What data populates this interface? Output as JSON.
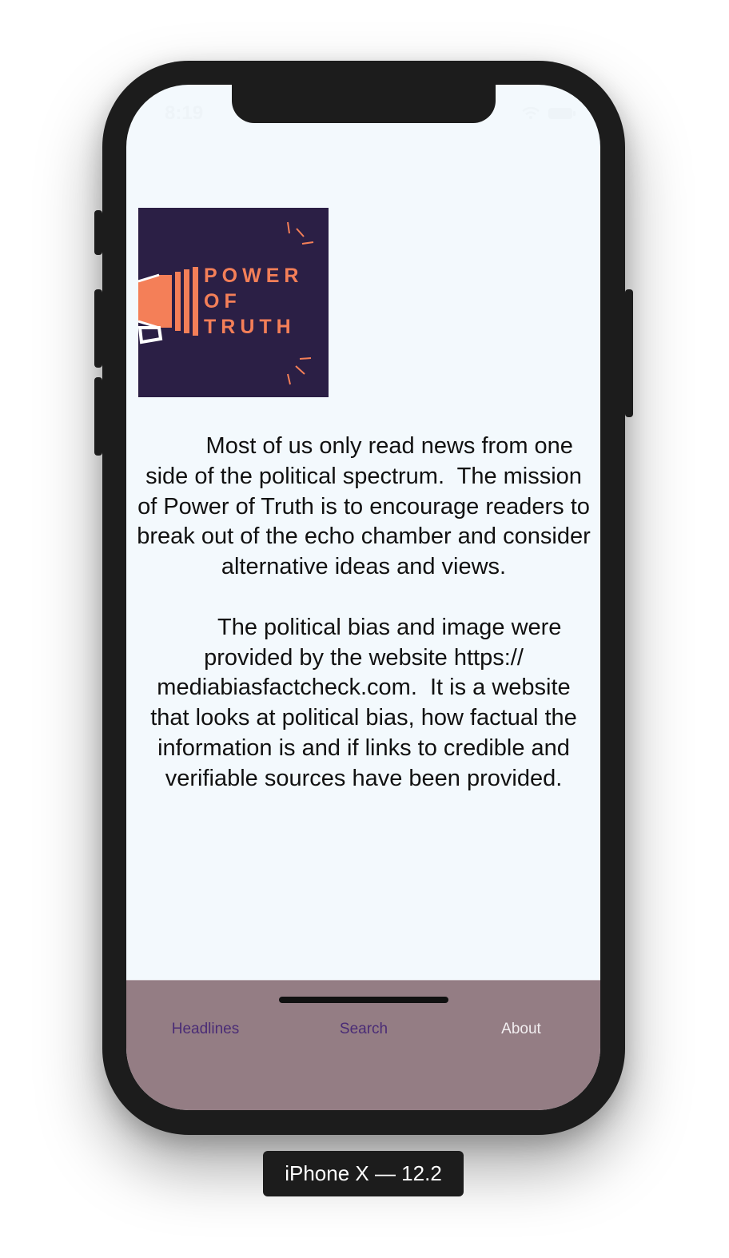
{
  "status_bar": {
    "time": "8:19"
  },
  "logo": {
    "line1": "POWER",
    "line2": "OF",
    "line3": "TRUTH",
    "background": "#2b1f45",
    "accent": "#f47f58"
  },
  "about": {
    "text": "        Most of us only read news from one side of the political spectrum.  The mission of Power of Truth is to encourage readers to break out of the echo chamber and consider alternative ideas and views.\n\n        The political bias and image were provided by the website https://\nmediabiasfactcheck.com.  It is a website that looks at political bias, how factual the information is and if links to credible and verifiable sources have been provided."
  },
  "tabbar": {
    "background": "#947d84",
    "tabs": [
      {
        "label": "Headlines",
        "color": "#4a2c76"
      },
      {
        "label": "Search",
        "color": "#4a2c76"
      },
      {
        "label": "About",
        "color": "#f2eef0"
      }
    ]
  },
  "device_label": "iPhone X — 12.2"
}
